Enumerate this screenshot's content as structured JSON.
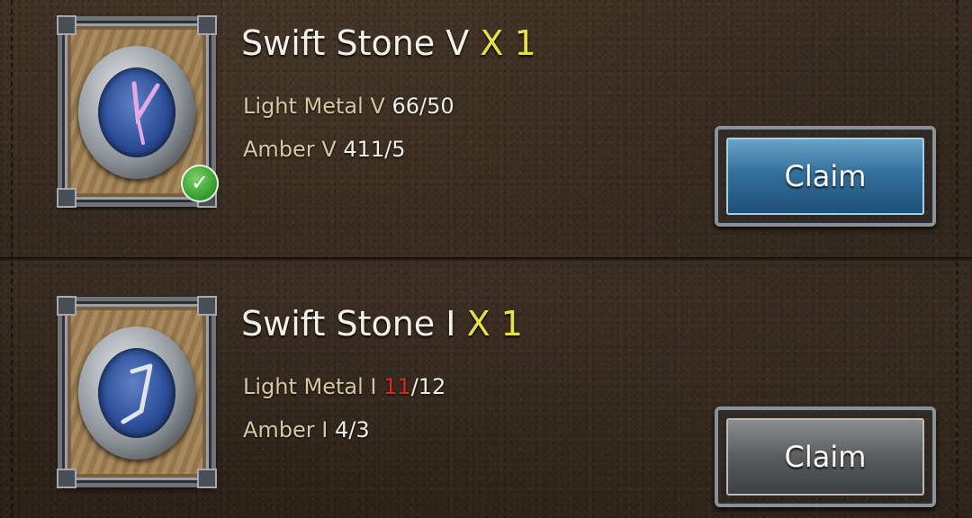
{
  "rewards": [
    {
      "name": "Swift Stone V",
      "quantity": "X 1",
      "requirements": [
        {
          "material": "Light Metal V",
          "have": "66",
          "need": "/50",
          "sufficient": true
        },
        {
          "material": "Amber V",
          "have": "411",
          "need": "/5",
          "sufficient": true
        }
      ],
      "claim_label": "Claim",
      "claimable": true,
      "completed_check": true
    },
    {
      "name": "Swift Stone I",
      "quantity": "X 1",
      "requirements": [
        {
          "material": "Light Metal I",
          "have": "11",
          "need": "/12",
          "sufficient": false
        },
        {
          "material": "Amber I",
          "have": "4",
          "need": "/3",
          "sufficient": true
        }
      ],
      "claim_label": "Claim",
      "claimable": false,
      "completed_check": false
    }
  ],
  "colors": {
    "quantity": "#e8e04a",
    "insufficient": "#e3261e",
    "material_label": "#d8c7a2",
    "claim_active": "#33709c",
    "claim_inactive": "#5a5c5e"
  },
  "icons": {
    "item": "swift-stone-icon",
    "check": "checkmark-icon"
  }
}
